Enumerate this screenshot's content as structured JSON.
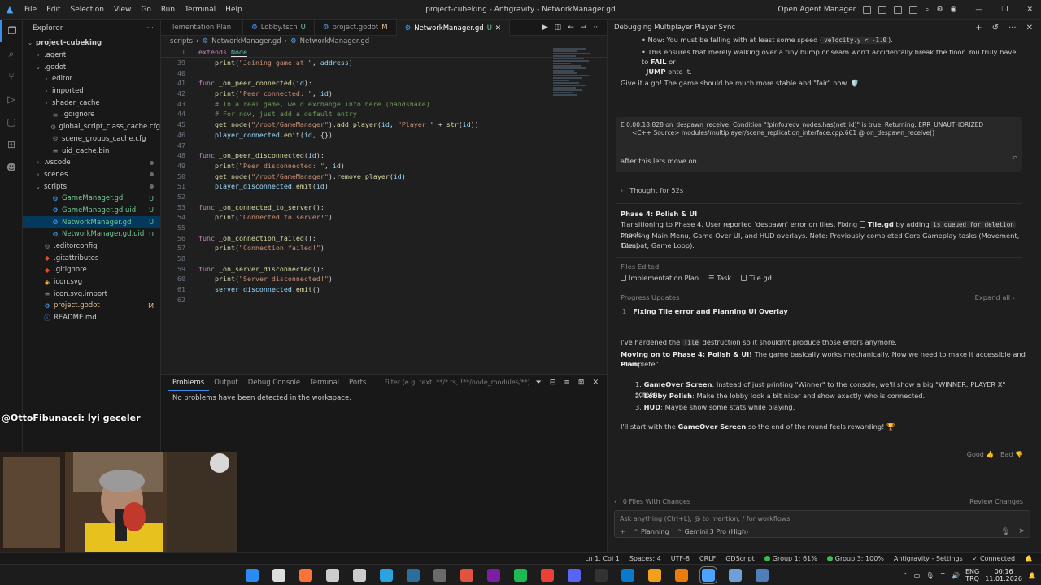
{
  "titlebar": {
    "menus": [
      "File",
      "Edit",
      "Selection",
      "View",
      "Go",
      "Run",
      "Terminal",
      "Help"
    ],
    "title": "project-cubeking - Antigravity - NetworkManager.gd",
    "open_agent_manager": "Open Agent Manager"
  },
  "explorer": {
    "header": "Explorer",
    "items": [
      {
        "label": "project-cubeking",
        "depth": 0,
        "type": "root",
        "chev": "⌄"
      },
      {
        "label": ".agent",
        "depth": 1,
        "type": "folder",
        "chev": "›"
      },
      {
        "label": ".godot",
        "depth": 1,
        "type": "folder",
        "chev": "⌄"
      },
      {
        "label": "editor",
        "depth": 2,
        "type": "folder",
        "chev": "›"
      },
      {
        "label": "imported",
        "depth": 2,
        "type": "folder",
        "chev": "›"
      },
      {
        "label": "shader_cache",
        "depth": 2,
        "type": "folder",
        "chev": "›"
      },
      {
        "label": ".gdignore",
        "depth": 2,
        "type": "file",
        "chev": ""
      },
      {
        "label": "global_script_class_cache.cfg",
        "depth": 2,
        "type": "cfg",
        "chev": ""
      },
      {
        "label": "scene_groups_cache.cfg",
        "depth": 2,
        "type": "cfg",
        "chev": ""
      },
      {
        "label": "uid_cache.bin",
        "depth": 2,
        "type": "file",
        "chev": ""
      },
      {
        "label": ".vscode",
        "depth": 1,
        "type": "folder",
        "chev": "›",
        "dot": true
      },
      {
        "label": "scenes",
        "depth": 1,
        "type": "folder",
        "chev": "›",
        "dot": true
      },
      {
        "label": "scripts",
        "depth": 1,
        "type": "folder",
        "chev": "⌄",
        "dot": true
      },
      {
        "label": "GameManager.gd",
        "depth": 2,
        "type": "gd",
        "chev": "",
        "badge": "U",
        "git": "u"
      },
      {
        "label": "GameManager.gd.uid",
        "depth": 2,
        "type": "gd",
        "chev": "",
        "badge": "U",
        "git": "u"
      },
      {
        "label": "NetworkManager.gd",
        "depth": 2,
        "type": "gd",
        "chev": "",
        "badge": "U",
        "git": "u",
        "selected": true
      },
      {
        "label": "NetworkManager.gd.uid",
        "depth": 2,
        "type": "gd",
        "chev": "",
        "badge": "U",
        "git": "u"
      },
      {
        "label": ".editorconfig",
        "depth": 1,
        "type": "cfg",
        "chev": ""
      },
      {
        "label": ".gitattributes",
        "depth": 1,
        "type": "git",
        "chev": ""
      },
      {
        "label": ".gitignore",
        "depth": 1,
        "type": "git",
        "chev": ""
      },
      {
        "label": "icon.svg",
        "depth": 1,
        "type": "svg",
        "chev": ""
      },
      {
        "label": "icon.svg.import",
        "depth": 1,
        "type": "file",
        "chev": ""
      },
      {
        "label": "project.godot",
        "depth": 1,
        "type": "godot",
        "chev": "",
        "badge": "M",
        "git": "m"
      },
      {
        "label": "README.md",
        "depth": 1,
        "type": "md",
        "chev": ""
      }
    ]
  },
  "tabs": [
    {
      "label": "lementation Plan",
      "suffix": "",
      "active": false
    },
    {
      "label": "Lobby.tscn",
      "suffix": "U",
      "active": false
    },
    {
      "label": "project.godot",
      "suffix": "M",
      "active": false
    },
    {
      "label": "NetworkManager.gd",
      "suffix": "U",
      "active": true
    }
  ],
  "breadcrumb": [
    "scripts",
    "NetworkManager.gd",
    "NetworkManager.gd"
  ],
  "editor": {
    "sticky": {
      "ln": "1",
      "kw": "extends",
      "type": "Node"
    },
    "lines": [
      {
        "ln": "39",
        "tokens": [
          {
            "t": "    "
          },
          {
            "t": "print",
            "c": "fn"
          },
          {
            "t": "("
          },
          {
            "t": "\"Joining game at \"",
            "c": "str"
          },
          {
            "t": ", "
          },
          {
            "t": "address",
            "c": "var"
          },
          {
            "t": ")"
          }
        ]
      },
      {
        "ln": "40",
        "tokens": []
      },
      {
        "ln": "41",
        "tokens": [
          {
            "t": "func",
            "c": "kw"
          },
          {
            "t": " "
          },
          {
            "t": "_on_peer_connected",
            "c": "fn"
          },
          {
            "t": "("
          },
          {
            "t": "id",
            "c": "var"
          },
          {
            "t": "):"
          }
        ]
      },
      {
        "ln": "42",
        "tokens": [
          {
            "t": "    "
          },
          {
            "t": "print",
            "c": "fn"
          },
          {
            "t": "("
          },
          {
            "t": "\"Peer connected: \"",
            "c": "str"
          },
          {
            "t": ", "
          },
          {
            "t": "id",
            "c": "var"
          },
          {
            "t": ")"
          }
        ]
      },
      {
        "ln": "43",
        "tokens": [
          {
            "t": "    "
          },
          {
            "t": "# In a real game, we'd exchange info here (handshake)",
            "c": "cmt"
          }
        ]
      },
      {
        "ln": "44",
        "tokens": [
          {
            "t": "    "
          },
          {
            "t": "# For now, just add a default entry",
            "c": "cmt"
          }
        ]
      },
      {
        "ln": "45",
        "tokens": [
          {
            "t": "    "
          },
          {
            "t": "get_node",
            "c": "fn"
          },
          {
            "t": "("
          },
          {
            "t": "\"/root/GameManager\"",
            "c": "str"
          },
          {
            "t": ")."
          },
          {
            "t": "add_player",
            "c": "fn"
          },
          {
            "t": "("
          },
          {
            "t": "id",
            "c": "var"
          },
          {
            "t": ", "
          },
          {
            "t": "\"Player_\"",
            "c": "str"
          },
          {
            "t": " + "
          },
          {
            "t": "str",
            "c": "fn"
          },
          {
            "t": "("
          },
          {
            "t": "id",
            "c": "var"
          },
          {
            "t": "))"
          }
        ]
      },
      {
        "ln": "46",
        "tokens": [
          {
            "t": "    "
          },
          {
            "t": "player_connected",
            "c": "var"
          },
          {
            "t": "."
          },
          {
            "t": "emit",
            "c": "fn"
          },
          {
            "t": "("
          },
          {
            "t": "id",
            "c": "var"
          },
          {
            "t": ", {})"
          }
        ]
      },
      {
        "ln": "47",
        "tokens": []
      },
      {
        "ln": "48",
        "tokens": [
          {
            "t": "func",
            "c": "kw"
          },
          {
            "t": " "
          },
          {
            "t": "_on_peer_disconnected",
            "c": "fn"
          },
          {
            "t": "("
          },
          {
            "t": "id",
            "c": "var"
          },
          {
            "t": "):"
          }
        ]
      },
      {
        "ln": "49",
        "tokens": [
          {
            "t": "    "
          },
          {
            "t": "print",
            "c": "fn"
          },
          {
            "t": "("
          },
          {
            "t": "\"Peer disconnected: \"",
            "c": "str"
          },
          {
            "t": ", "
          },
          {
            "t": "id",
            "c": "var"
          },
          {
            "t": ")"
          }
        ]
      },
      {
        "ln": "50",
        "tokens": [
          {
            "t": "    "
          },
          {
            "t": "get_node",
            "c": "fn"
          },
          {
            "t": "("
          },
          {
            "t": "\"/root/GameManager\"",
            "c": "str"
          },
          {
            "t": ")."
          },
          {
            "t": "remove_player",
            "c": "fn"
          },
          {
            "t": "("
          },
          {
            "t": "id",
            "c": "var"
          },
          {
            "t": ")"
          }
        ]
      },
      {
        "ln": "51",
        "tokens": [
          {
            "t": "    "
          },
          {
            "t": "player_disconnected",
            "c": "var"
          },
          {
            "t": "."
          },
          {
            "t": "emit",
            "c": "fn"
          },
          {
            "t": "("
          },
          {
            "t": "id",
            "c": "var"
          },
          {
            "t": ")"
          }
        ]
      },
      {
        "ln": "52",
        "tokens": []
      },
      {
        "ln": "53",
        "tokens": [
          {
            "t": "func",
            "c": "kw"
          },
          {
            "t": " "
          },
          {
            "t": "_on_connected_to_server",
            "c": "fn"
          },
          {
            "t": "():"
          }
        ]
      },
      {
        "ln": "54",
        "tokens": [
          {
            "t": "    "
          },
          {
            "t": "print",
            "c": "fn"
          },
          {
            "t": "("
          },
          {
            "t": "\"Connected to server!\"",
            "c": "str"
          },
          {
            "t": ")"
          }
        ]
      },
      {
        "ln": "55",
        "tokens": []
      },
      {
        "ln": "56",
        "tokens": [
          {
            "t": "func",
            "c": "kw"
          },
          {
            "t": " "
          },
          {
            "t": "_on_connection_failed",
            "c": "fn"
          },
          {
            "t": "():"
          }
        ]
      },
      {
        "ln": "57",
        "tokens": [
          {
            "t": "    "
          },
          {
            "t": "print",
            "c": "fn"
          },
          {
            "t": "("
          },
          {
            "t": "\"Connection failed!\"",
            "c": "str"
          },
          {
            "t": ")"
          }
        ]
      },
      {
        "ln": "58",
        "tokens": []
      },
      {
        "ln": "59",
        "tokens": [
          {
            "t": "func",
            "c": "kw"
          },
          {
            "t": " "
          },
          {
            "t": "_on_server_disconnected",
            "c": "fn"
          },
          {
            "t": "():"
          }
        ]
      },
      {
        "ln": "60",
        "tokens": [
          {
            "t": "    "
          },
          {
            "t": "print",
            "c": "fn"
          },
          {
            "t": "("
          },
          {
            "t": "\"Server disconnected!\"",
            "c": "str"
          },
          {
            "t": ")"
          }
        ]
      },
      {
        "ln": "61",
        "tokens": [
          {
            "t": "    "
          },
          {
            "t": "server_disconnected",
            "c": "var"
          },
          {
            "t": "."
          },
          {
            "t": "emit",
            "c": "fn"
          },
          {
            "t": "()"
          }
        ]
      },
      {
        "ln": "62",
        "tokens": []
      }
    ]
  },
  "panel": {
    "tabs": [
      "Problems",
      "Output",
      "Debug Console",
      "Terminal",
      "Ports"
    ],
    "filter_placeholder": "Filter (e.g. text, **/*.ts, !**/node_modules/**)",
    "message": "No problems have been detected in the workspace."
  },
  "overlay": {
    "text": "@OttoFibunacci: İyi geceler"
  },
  "agent": {
    "header": "Debugging Multiplayer Player Sync",
    "bullet1_pre": "Now: You must be falling with at least some speed (",
    "bullet1_code": "velocity.y < -1.0",
    "bullet1_post": ").",
    "bullet2_a": "This ensures that merely walking over a tiny bump or seam won't accidentally break the floor. You truly have to ",
    "bullet2_b1": "FAIL",
    "bullet2_c": " or",
    "bullet2_b2": "JUMP",
    "bullet2_d": " onto it.",
    "give_go": "Give it a go! The game should be much more stable and \"fair\" now. 🛡️",
    "error_line1": "E 0:00:18:828   on_despawn_receive: Condition \"!pinfo.recv_nodes.has(net_id)\" is true. Returning: ERR_UNAUTHORIZED",
    "error_line2": "<C++ Source>  modules/multiplayer/scene_replication_interface.cpp:661 @ on_despawn_receive()",
    "user_msg": "after this lets move on",
    "thought": "Thought for 52s",
    "phase_title": "Phase 4: Polish & UI",
    "phase_a": "Transitioning to Phase 4. User reported 'despawn' error on tiles. Fixing ",
    "phase_file": "Tile.gd",
    "phase_b": " by adding ",
    "phase_code": "is_queued_for_deletion",
    "phase_c": " check.",
    "phase_line2": "Planning Main Menu, Game Over UI, and HUD overlays. Note: Previously completed Core Gameplay tasks (Movement, Tiles,",
    "phase_line3": "Combat, Game Loop).",
    "files_edited": "Files Edited",
    "files": [
      "Implementation Plan",
      "Task",
      "Tile.gd"
    ],
    "progress_updates": "Progress Updates",
    "expand_all": "Expand all",
    "progress_num": "1",
    "progress_item": "Fixing Tile error and Planning UI Overlay",
    "resp_a": "I've hardened the ",
    "resp_code": "Tile",
    "resp_b": " destruction so it shouldn't produce those errors anymore.",
    "moving_bold": "Moving on to Phase 4: Polish & UI!",
    "moving_rest": " The game basically works mechanically. Now we need to make it accessible and \"complete\".",
    "plan_label": "Plan:",
    "plan": [
      {
        "n": "1.",
        "b": "GameOver Screen",
        "t": ": Instead of just printing \"Winner\" to the console, we'll show a big \"WINNER: PLAYER X\" screen."
      },
      {
        "n": "2.",
        "b": "Lobby Polish",
        "t": ": Make the lobby look a bit nicer and show exactly who is connected."
      },
      {
        "n": "3.",
        "b": "HUD",
        "t": ": Maybe show some stats while playing."
      }
    ],
    "start_a": "I'll start with the ",
    "start_b": "GameOver Screen",
    "start_c": " so the end of the round feels rewarding! 🏆",
    "good": "Good",
    "bad": "Bad",
    "files_changes": "0 Files With Changes",
    "review": "Review Changes",
    "input_placeholder": "Ask anything (Ctrl+L), @ to mention, / for workflows",
    "mode": "Planning",
    "model": "Gemini 3 Pro (High)"
  },
  "statusbar": [
    "Ln 1, Col 1",
    "Spaces: 4",
    "UTF-8",
    "CRLF",
    "GDScript",
    "Group 1: 61%",
    "Group 3: 100%",
    "Antigravity - Settings",
    "Connected"
  ],
  "tray": {
    "lang": "ENG",
    "region": "TRQ",
    "time": "00:16",
    "date": "11.01.2026"
  }
}
